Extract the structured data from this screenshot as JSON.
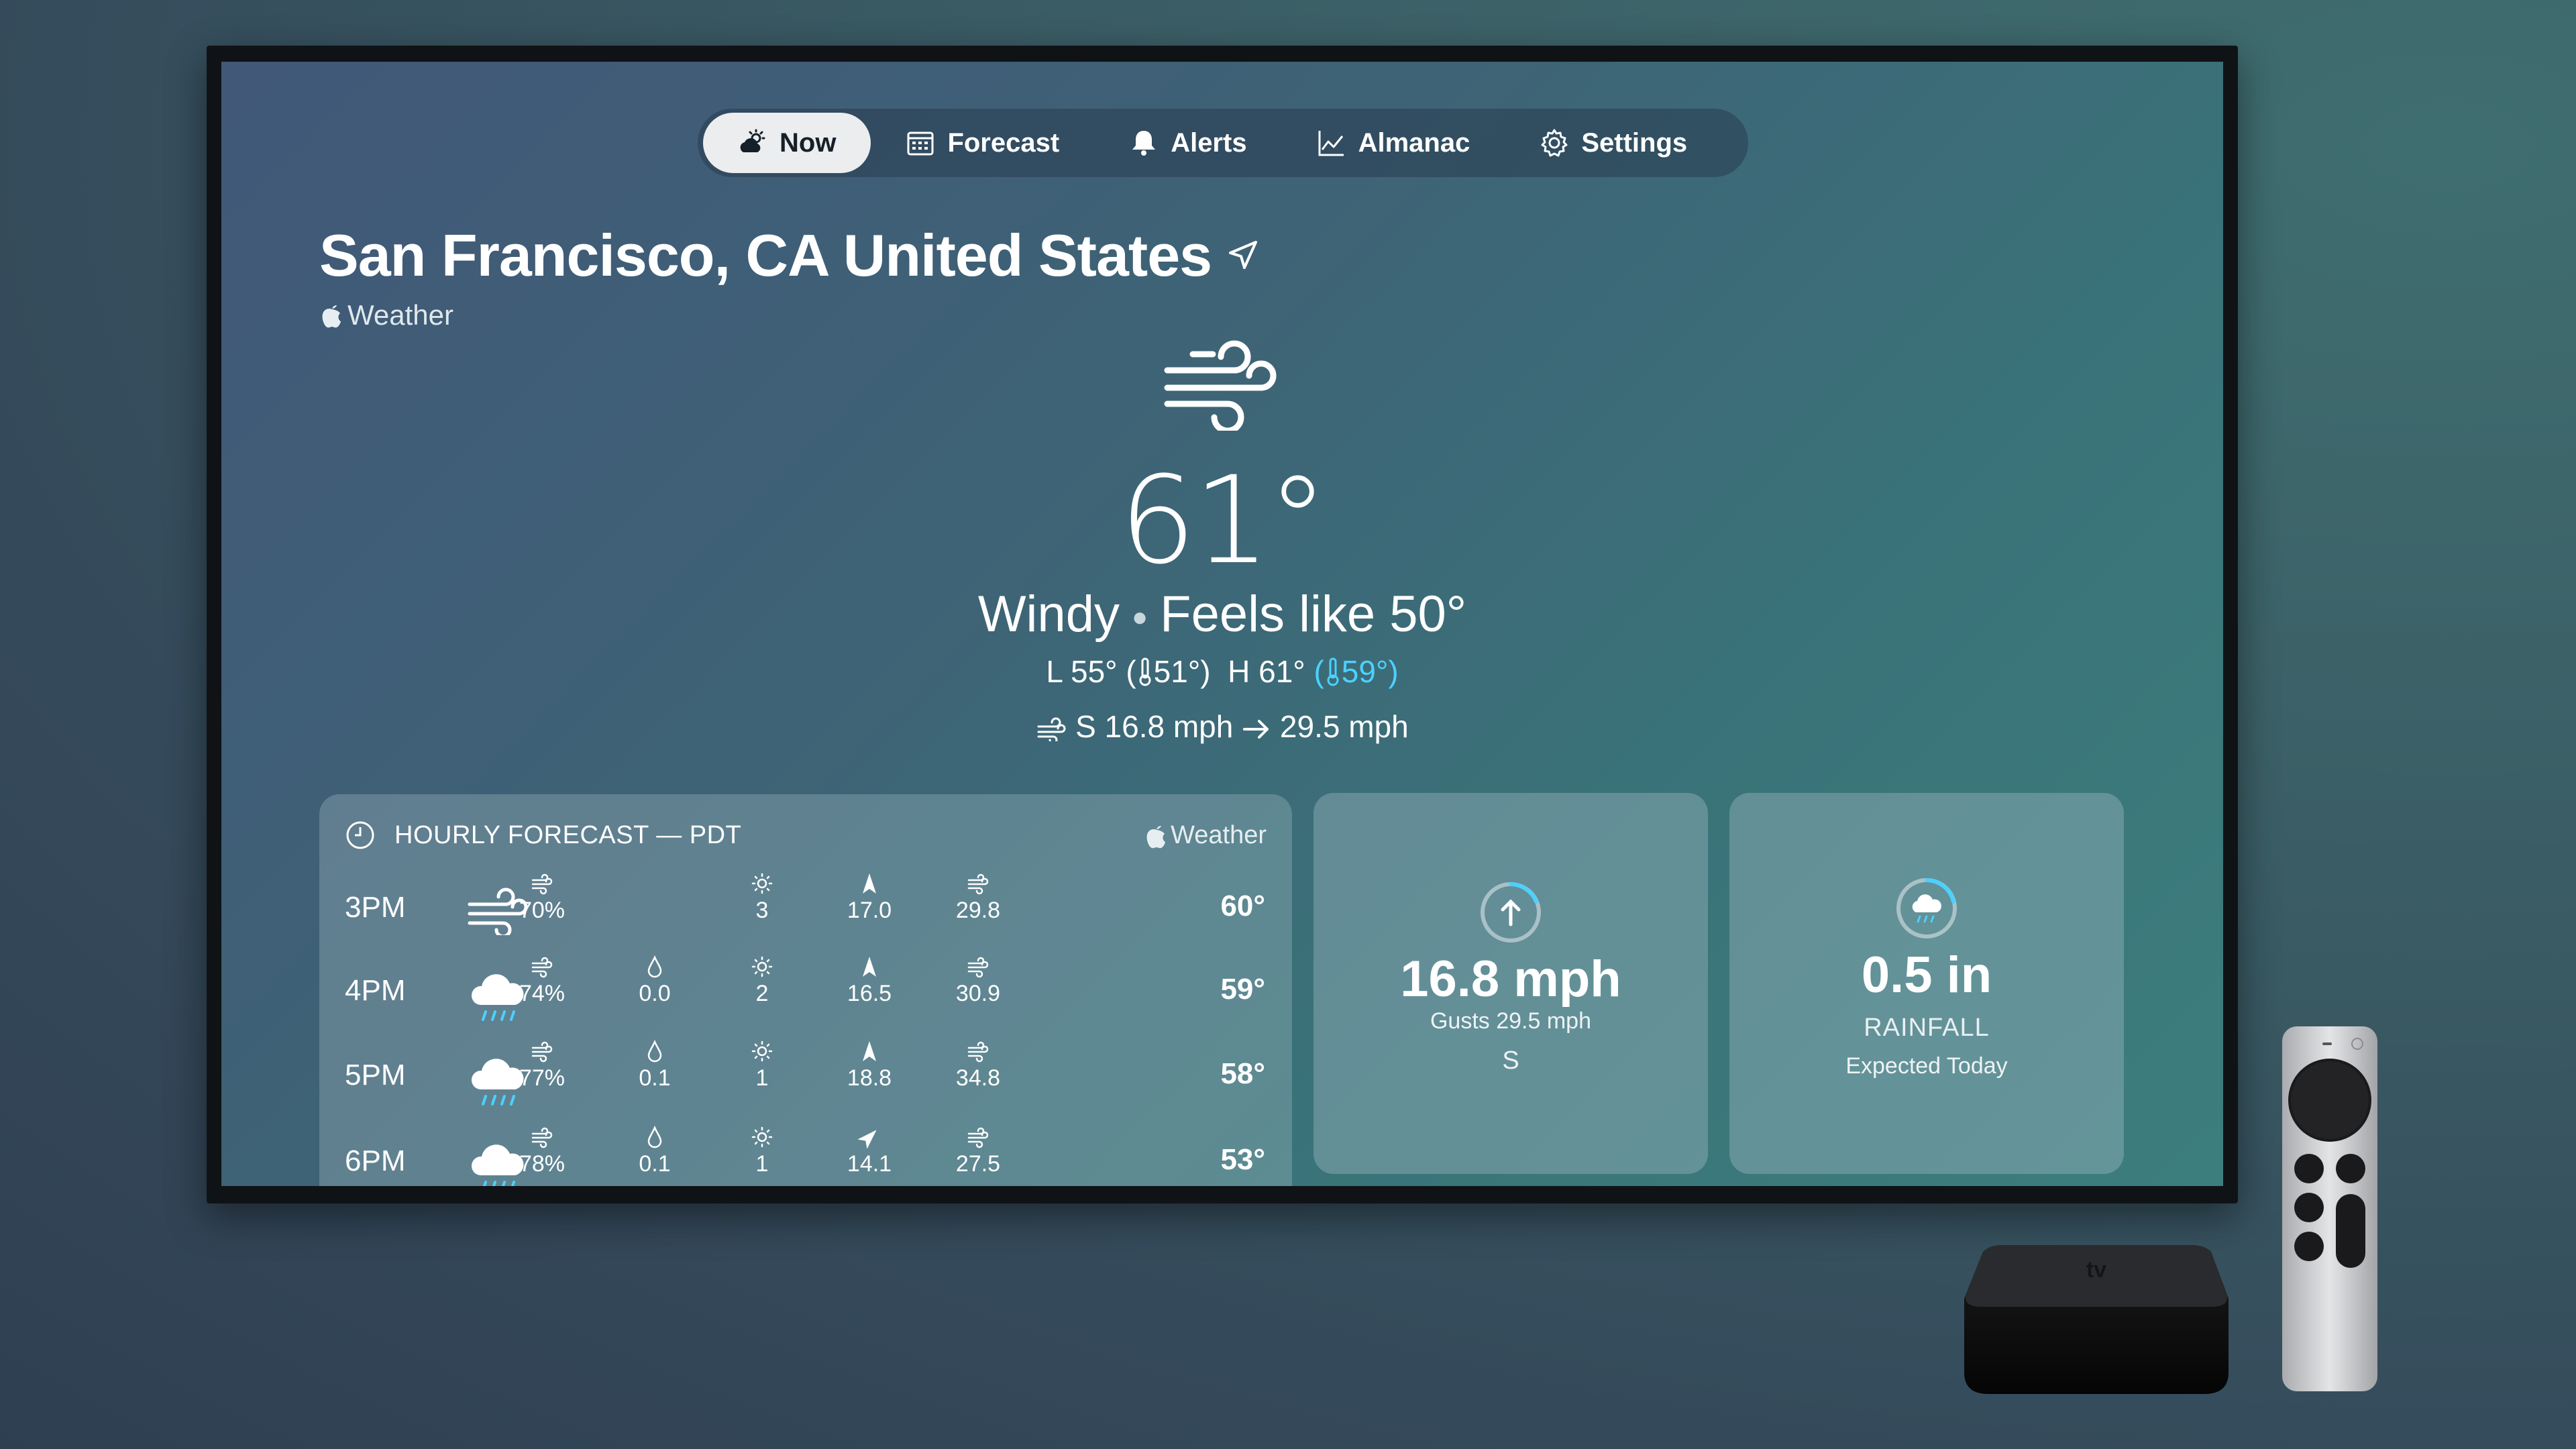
{
  "nav": {
    "items": [
      {
        "label": "Now",
        "icon": "weather-now-icon",
        "active": true
      },
      {
        "label": "Forecast",
        "icon": "calendar-icon",
        "active": false
      },
      {
        "label": "Alerts",
        "icon": "bell-icon",
        "active": false
      },
      {
        "label": "Almanac",
        "icon": "chart-icon",
        "active": false
      },
      {
        "label": "Settings",
        "icon": "gear-icon",
        "active": false
      }
    ]
  },
  "current": {
    "location": "San Francisco, CA United States",
    "source": "Weather",
    "icon": "wind-icon",
    "temperature": "61°",
    "condition": "Windy",
    "feels_like": "Feels like 50°",
    "low": "L 55°",
    "low_feels": "51°)",
    "high": "H 61°",
    "high_feels": "59°)",
    "wind": "S 16.8 mph",
    "gust": "29.5 mph"
  },
  "hourly": {
    "title": "HOURLY FORECAST — PDT",
    "source": "Weather",
    "rows": [
      {
        "time": "3PM",
        "icon": "wind-icon",
        "humidity": "70%",
        "precip": "",
        "uv": "3",
        "wind": "17.0",
        "wind_dir": "north",
        "gust": "29.8",
        "temp": "60°"
      },
      {
        "time": "4PM",
        "icon": "rain-cloud-icon",
        "humidity": "74%",
        "precip": "0.0",
        "uv": "2",
        "wind": "16.5",
        "wind_dir": "north",
        "gust": "30.9",
        "temp": "59°"
      },
      {
        "time": "5PM",
        "icon": "rain-cloud-icon",
        "humidity": "77%",
        "precip": "0.1",
        "uv": "1",
        "wind": "18.8",
        "wind_dir": "north",
        "gust": "34.8",
        "temp": "58°"
      },
      {
        "time": "6PM",
        "icon": "rain-cloud-icon",
        "humidity": "78%",
        "precip": "0.1",
        "uv": "1",
        "wind": "14.1",
        "wind_dir": "northeast",
        "gust": "27.5",
        "temp": "53°"
      }
    ]
  },
  "wind_card": {
    "value": "16.8 mph",
    "gusts": "Gusts 29.5 mph",
    "direction": "S"
  },
  "rain_card": {
    "value": "0.5 in",
    "label": "RAINFALL",
    "sub": "Expected Today"
  },
  "colors": {
    "accent_cyan": "#4cd1ff",
    "active_tab": "#ecedee"
  }
}
